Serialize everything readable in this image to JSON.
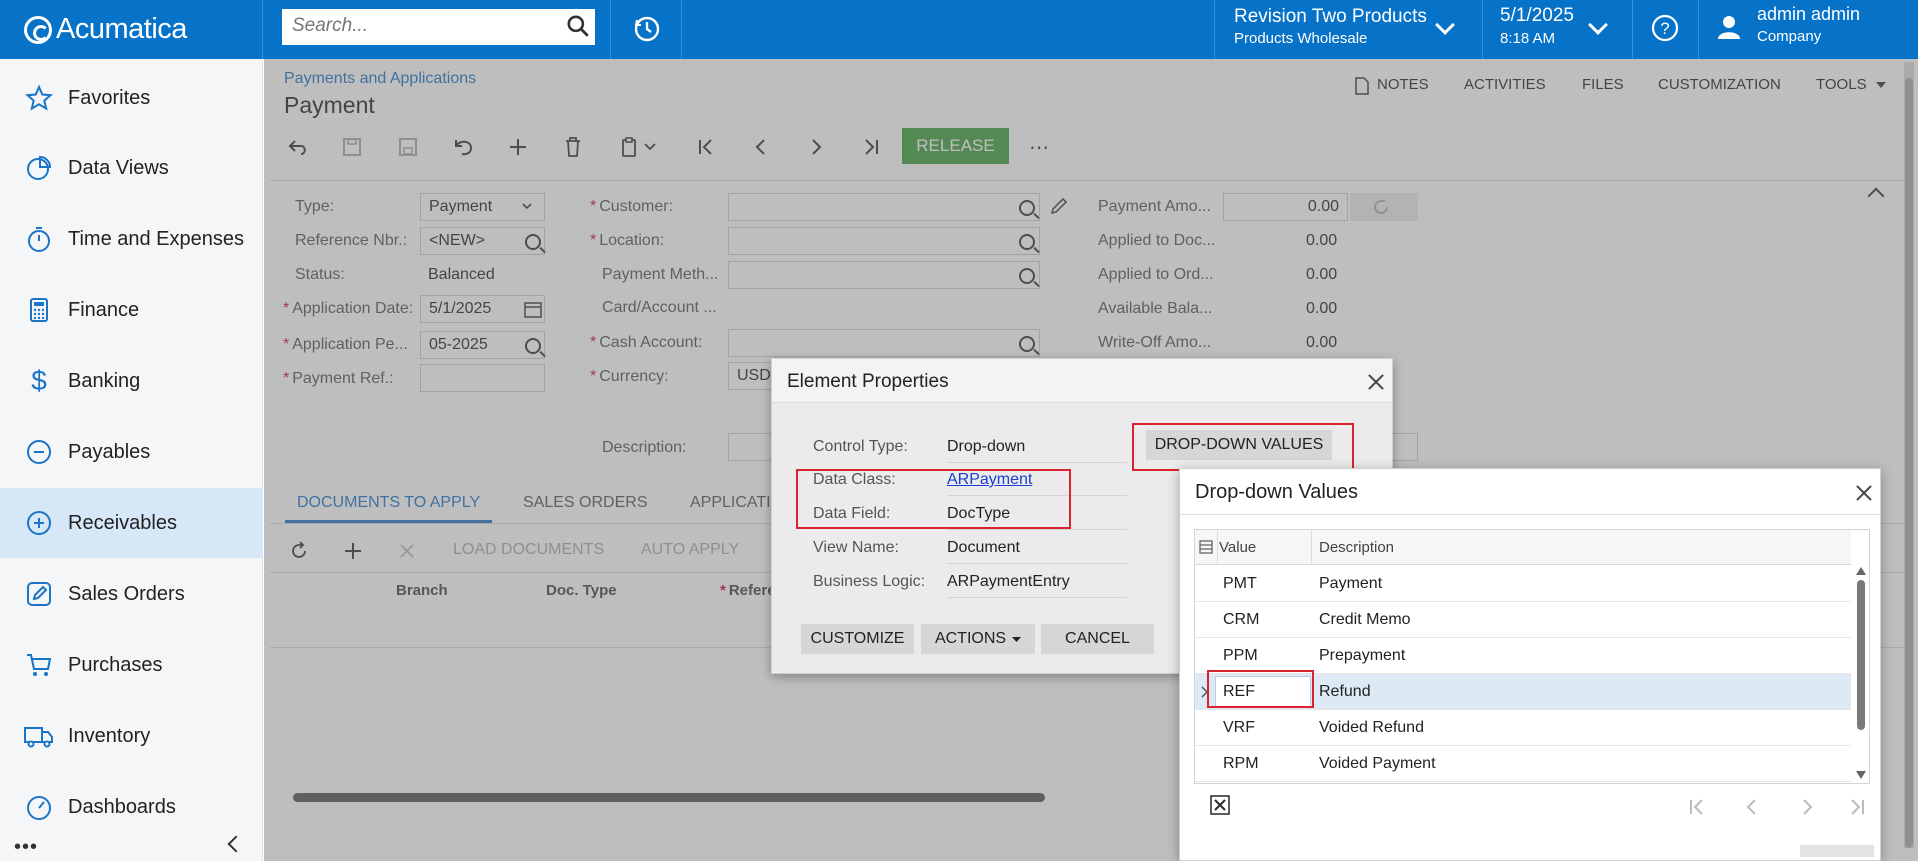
{
  "topbar": {
    "brand": "Acumatica",
    "search_placeholder": "Search...",
    "company_name": "Revision Two Products",
    "branch_name": "Products Wholesale",
    "date": "5/1/2025",
    "time": "8:18 AM",
    "user_name": "admin admin",
    "user_company": "Company"
  },
  "sidebar": {
    "items": [
      {
        "label": "Favorites",
        "icon": "star-icon"
      },
      {
        "label": "Data Views",
        "icon": "pie-chart-icon"
      },
      {
        "label": "Time and Expenses",
        "icon": "stopwatch-icon"
      },
      {
        "label": "Finance",
        "icon": "calculator-icon"
      },
      {
        "label": "Banking",
        "icon": "dollar-icon"
      },
      {
        "label": "Payables",
        "icon": "minus-circle-icon"
      },
      {
        "label": "Receivables",
        "icon": "plus-circle-icon"
      },
      {
        "label": "Sales Orders",
        "icon": "edit-icon"
      },
      {
        "label": "Purchases",
        "icon": "cart-icon"
      },
      {
        "label": "Inventory",
        "icon": "truck-icon"
      },
      {
        "label": "Dashboards",
        "icon": "gauge-icon"
      }
    ],
    "more": "•••"
  },
  "page": {
    "breadcrumb": "Payments and Applications",
    "title": "Payment",
    "top_links": [
      "NOTES",
      "ACTIVITIES",
      "FILES",
      "CUSTOMIZATION",
      "TOOLS"
    ],
    "release_label": "RELEASE"
  },
  "form": {
    "type_label": "Type:",
    "type_value": "Payment",
    "refnbr_label": "Reference Nbr.:",
    "refnbr_value": "<NEW>",
    "status_label": "Status:",
    "status_value": "Balanced",
    "appdate_label": "Application Date:",
    "appdate_value": "5/1/2025",
    "appperiod_label": "Application Pe...",
    "appperiod_value": "05-2025",
    "payref_label": "Payment Ref.:",
    "customer_label": "Customer:",
    "location_label": "Location:",
    "paymethod_label": "Payment Meth...",
    "cardaccount_label": "Card/Account ...",
    "cashaccount_label": "Cash Account:",
    "currency_label": "Currency:",
    "currency_value": "USD",
    "description_label": "Description:",
    "paymentamt_label": "Payment Amo...",
    "paymentamt_value": "0.00",
    "appliedtodoc_label": "Applied to Doc...",
    "appliedtodoc_value": "0.00",
    "appliedtoord_label": "Applied to Ord...",
    "appliedtoord_value": "0.00",
    "availablebal_label": "Available Bala...",
    "availablebal_value": "0.00",
    "writeoff_label": "Write-Off Amo...",
    "writeoff_value": "0.00"
  },
  "tabs": [
    "DOCUMENTS TO APPLY",
    "SALES ORDERS",
    "APPLICATI"
  ],
  "grid": {
    "load_documents": "LOAD DOCUMENTS",
    "auto_apply": "AUTO APPLY",
    "columns": [
      "Branch",
      "Doc. Type",
      "Refere"
    ]
  },
  "element_properties": {
    "title": "Element Properties",
    "rows": [
      {
        "label": "Control Type:",
        "value": "Drop-down"
      },
      {
        "label": "Data Class:",
        "value": "ARPayment"
      },
      {
        "label": "Data Field:",
        "value": "DocType"
      },
      {
        "label": "View Name:",
        "value": "Document"
      },
      {
        "label": "Business Logic:",
        "value": "ARPaymentEntry"
      }
    ],
    "dropdown_values_button": "DROP-DOWN VALUES",
    "customize_button": "CUSTOMIZE",
    "actions_button": "ACTIONS",
    "cancel_button": "CANCEL"
  },
  "dropdown_values": {
    "title": "Drop-down Values",
    "columns": [
      "Value",
      "Description"
    ],
    "rows": [
      {
        "value": "PMT",
        "description": "Payment"
      },
      {
        "value": "CRM",
        "description": "Credit Memo"
      },
      {
        "value": "PPM",
        "description": "Prepayment"
      },
      {
        "value": "REF",
        "description": "Refund"
      },
      {
        "value": "VRF",
        "description": "Voided Refund"
      },
      {
        "value": "RPM",
        "description": "Voided Payment"
      }
    ],
    "selected_value": "REF"
  },
  "colors": {
    "topbar": "#0672c8",
    "accent": "#1b74c7",
    "release": "#3f9e3f",
    "highlight": "#d9232e"
  }
}
